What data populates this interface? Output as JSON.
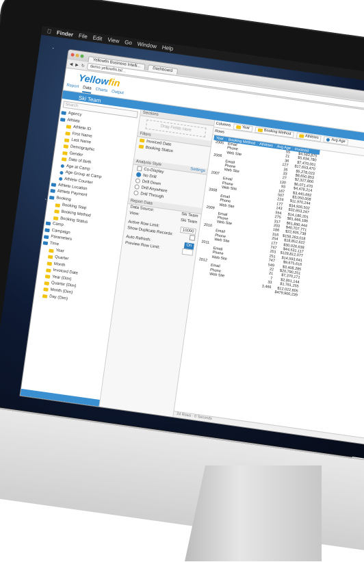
{
  "menubar": {
    "items": [
      "Finder",
      "File",
      "Edit",
      "View",
      "Go",
      "Window",
      "Help"
    ]
  },
  "browser": {
    "tabs": [
      "Yellowfin Business Intelli...",
      "Dashboard"
    ],
    "url": "demo.yellowfin.bi/..."
  },
  "app": {
    "logo_main": "Yellow",
    "logo_accent": "fin",
    "nav_tabs": [
      "Report",
      "Data",
      "Charts",
      "Output"
    ],
    "active_tab": "Data",
    "report_title": "Ski Team"
  },
  "left": {
    "search_placeholder": "Search",
    "tree": [
      {
        "label": "Agency",
        "type": "folder"
      },
      {
        "label": "Athlete",
        "type": "folder"
      },
      {
        "label": "Athlete ID",
        "type": "field"
      },
      {
        "label": "First Name",
        "type": "field"
      },
      {
        "label": "Last Name",
        "type": "field"
      },
      {
        "label": "Demographic",
        "type": "field"
      },
      {
        "label": "Gender",
        "type": "field"
      },
      {
        "label": "Date of Birth",
        "type": "field"
      },
      {
        "label": "Age at Camp",
        "type": "dot"
      },
      {
        "label": "Age Group at Camp",
        "type": "dot"
      },
      {
        "label": "Athlete Counter",
        "type": "dot"
      },
      {
        "label": "Athlete Location",
        "type": "folder"
      },
      {
        "label": "Athlete Payment",
        "type": "folder"
      },
      {
        "label": "Booking",
        "type": "folder"
      },
      {
        "label": "Booking Step",
        "type": "field"
      },
      {
        "label": "Booking Method",
        "type": "field"
      },
      {
        "label": "Booking Status",
        "type": "field"
      },
      {
        "label": "Camp",
        "type": "folder"
      },
      {
        "label": "Campaign",
        "type": "folder"
      },
      {
        "label": "Parameters",
        "type": "folder"
      },
      {
        "label": "Time",
        "type": "folder"
      },
      {
        "label": "Year",
        "type": "field"
      },
      {
        "label": "Quarter",
        "type": "field"
      },
      {
        "label": "Month",
        "type": "field"
      },
      {
        "label": "Invoiced Date",
        "type": "field"
      },
      {
        "label": "Year (Dim)",
        "type": "field"
      },
      {
        "label": "Quarter (Dim)",
        "type": "field"
      },
      {
        "label": "Month (Dim)",
        "type": "field"
      },
      {
        "label": "Day (Dim)",
        "type": "field"
      }
    ]
  },
  "mid": {
    "sections_label": "Sections",
    "drop_label": "Drag Fields Here",
    "filters_label": "Filters",
    "filters": [
      "Invoiced Date",
      "Booking Status"
    ],
    "analysis_label": "Analysis Style",
    "settings_label": "Settings",
    "options": [
      "Co-Display",
      "No Drill",
      "Drill Down",
      "Drill Anywhere",
      "Drill Through"
    ],
    "report_data_label": "Report Data",
    "data_source_label": "Data Source:",
    "data_source_value": "Ski Team",
    "view_label": "View:",
    "view_value": "Ski Team",
    "active_row_label": "Active Row Limit:",
    "active_row_value": "10000",
    "duplicates_label": "Show Duplicate Records:",
    "auto_refresh_label": "Auto Refresh:",
    "auto_refresh_value": "On",
    "preview_label": "Preview Row Limit:"
  },
  "right": {
    "columns_label": "Columns",
    "rows_label": "Rows",
    "column_chips": [
      "Year",
      "Booking Method",
      "Athletes",
      "Avg Age"
    ],
    "headers": [
      "Year",
      "Booking Method",
      "Athletes",
      "Avg Age",
      "Invoiced"
    ],
    "rows": [
      [
        "2005",
        "Email",
        "",
        "55",
        "$4,583,875"
      ],
      [
        "",
        "Phone",
        "",
        "21",
        "$5,634,780"
      ],
      [
        "",
        "Web Site",
        "",
        "36",
        "$7,470,001"
      ],
      [
        "2006",
        "",
        "",
        "127",
        "$17,653,470"
      ],
      [
        "",
        "Email",
        "",
        "35",
        "$5,278,023"
      ],
      [
        "",
        "Phone",
        "",
        "33",
        "$8,650,853"
      ],
      [
        "",
        "Web Site",
        "",
        "27",
        "$2,327,800"
      ],
      [
        "2007",
        "",
        "",
        "130",
        "$6,071,470"
      ],
      [
        "",
        "Email",
        "",
        "93",
        "$4,478,214"
      ],
      [
        "",
        "Phone",
        "",
        "167",
        "$3,445,692"
      ],
      [
        "",
        "Web Site",
        "",
        "507",
        "$3,050,008"
      ],
      [
        "2008",
        "",
        "",
        "224",
        "$11,970,244"
      ],
      [
        "",
        "Email",
        "",
        "177",
        "$34,926,502"
      ],
      [
        "",
        "Phone",
        "",
        "143",
        "$32,653,247"
      ],
      [
        "",
        "Web Site",
        "",
        "554",
        "$14,180,201"
      ],
      [
        "2009",
        "",
        "",
        "275",
        "$81,666,186"
      ],
      [
        "",
        "Email",
        "",
        "317",
        "$61,890,444"
      ],
      [
        "",
        "Phone",
        "",
        "203",
        "$40,707,771"
      ],
      [
        "",
        "Web Site",
        "",
        "186",
        "$22,605,738"
      ],
      [
        "2010",
        "",
        "",
        "316",
        "$158,263,018"
      ],
      [
        "",
        "Email",
        "",
        "254",
        "$18,852,622"
      ],
      [
        "",
        "Phone",
        "",
        "177",
        "$30,026,638"
      ],
      [
        "",
        "Web Site",
        "",
        "747",
        "$44,531,117"
      ],
      [
        "2011",
        "",
        "",
        "201",
        "$128,812,077"
      ],
      [
        "",
        "Email",
        "",
        "251",
        "$14,593,641"
      ],
      [
        "",
        "Phone",
        "",
        "747",
        "$9,675,616"
      ],
      [
        "",
        "Web Site",
        "",
        "549",
        "$3,408,285"
      ],
      [
        "2012",
        "",
        "",
        "22",
        "$20,790,251"
      ],
      [
        "",
        "Email",
        "",
        "21",
        "$7,370,171"
      ],
      [
        "",
        "Phone",
        "",
        "7",
        "$2,851,144"
      ],
      [
        "",
        "Web Site",
        "",
        "33",
        "$1,761,255"
      ],
      [
        "",
        "",
        "",
        "3,466",
        "$12,022,605"
      ],
      [
        "",
        "",
        "",
        "",
        "$479,900,239"
      ]
    ],
    "status": "24 Rows · 0 Seconds"
  }
}
